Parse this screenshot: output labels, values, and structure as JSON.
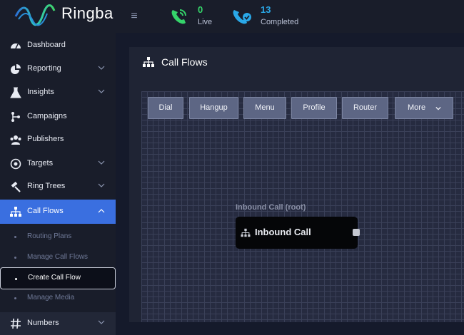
{
  "app": {
    "name": "Ringba"
  },
  "stats": [
    {
      "value": "0",
      "label": "Live",
      "color": "#35d46a"
    },
    {
      "value": "13",
      "label": "Completed",
      "color": "#2aa8e8"
    }
  ],
  "sidebar": {
    "items": [
      {
        "label": "Dashboard",
        "icon": "dashboard-icon"
      },
      {
        "label": "Reporting",
        "icon": "pie-chart-icon"
      },
      {
        "label": "Insights",
        "icon": "flask-icon"
      },
      {
        "label": "Campaigns",
        "icon": "branch-icon"
      },
      {
        "label": "Publishers",
        "icon": "users-icon"
      },
      {
        "label": "Targets",
        "icon": "target-icon"
      },
      {
        "label": "Ring Trees",
        "icon": "gavel-icon"
      },
      {
        "label": "Call Flows",
        "icon": "sitemap-icon"
      },
      {
        "label": "Numbers",
        "icon": "hash-icon"
      }
    ],
    "sub_items": [
      {
        "label": "Routing Plans"
      },
      {
        "label": "Manage Call Flows"
      },
      {
        "label": "Create Call Flow"
      },
      {
        "label": "Manage Media"
      }
    ]
  },
  "main": {
    "title": "Call Flows",
    "toolbar": [
      "Dial",
      "Hangup",
      "Menu",
      "Profile",
      "Router",
      "More"
    ],
    "node": {
      "caption": "Inbound Call (root)",
      "title": "Inbound Call"
    }
  },
  "colors": {
    "accent": "#3a6fe0",
    "sidebar": "#191d2a",
    "canvas": "#262b40"
  }
}
